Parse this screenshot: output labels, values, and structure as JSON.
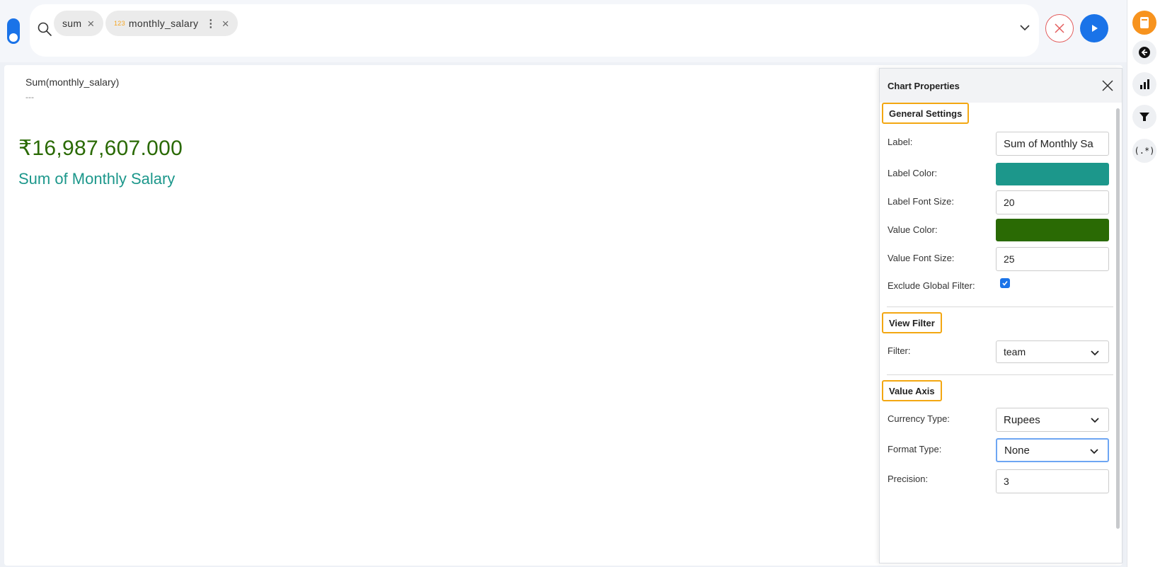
{
  "search": {
    "chips": [
      {
        "label": "sum"
      },
      {
        "prefix": "123",
        "label": "monthly_salary"
      }
    ]
  },
  "kpi": {
    "title": "Sum(monthly_salary)",
    "subtitle": "---",
    "value": "₹16,987,607.000",
    "label": "Sum of Monthly Salary",
    "value_color": "#2a6a04",
    "label_color": "#1c978b"
  },
  "panel": {
    "title": "Chart Properties",
    "general": {
      "heading": "General Settings",
      "label_label": "Label:",
      "label_value": "Sum of Monthly Sa",
      "label_color_label": "Label Color:",
      "label_color": "#1c978b",
      "label_font_label": "Label Font Size:",
      "label_font_value": "20",
      "value_color_label": "Value Color:",
      "value_color": "#2a6a04",
      "value_font_label": "Value Font Size:",
      "value_font_value": "25",
      "exclude_label": "Exclude Global Filter:",
      "exclude_checked": true
    },
    "view_filter": {
      "heading": "View Filter",
      "filter_label": "Filter:",
      "filter_value": "team"
    },
    "value_axis": {
      "heading": "Value Axis",
      "currency_label": "Currency Type:",
      "currency_value": "Rupees",
      "format_label": "Format Type:",
      "format_value": "None",
      "precision_label": "Precision:",
      "precision_value": "3"
    }
  },
  "rail": {
    "items": [
      {
        "icon": "document-icon"
      },
      {
        "icon": "back-arrow-icon"
      },
      {
        "icon": "bar-chart-icon"
      },
      {
        "icon": "filter-icon"
      },
      {
        "icon": "regex-icon",
        "text": "(.*)"
      }
    ]
  },
  "colors": {
    "accent": "#1a73e8",
    "highlight": "#f3a712",
    "rail_active": "#f7931e"
  }
}
